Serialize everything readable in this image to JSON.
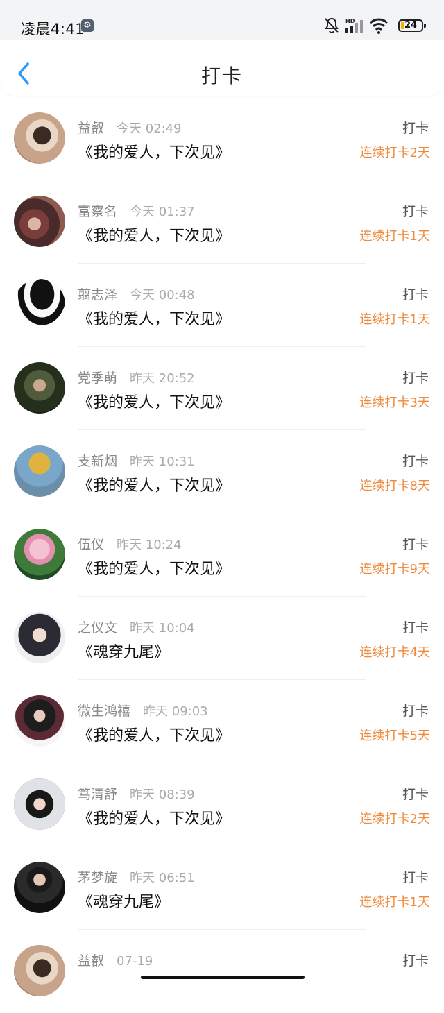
{
  "status_bar": {
    "time": "凌晨4:41",
    "battery": "24",
    "icons": [
      "gear-icon",
      "bell-off-icon",
      "signal-icon",
      "wifi-icon",
      "battery-icon"
    ]
  },
  "header": {
    "title": "打卡",
    "back_icon": "chevron-left-icon"
  },
  "colors": {
    "accent_blue": "#2e9bff",
    "streak_orange": "#ee8a3c",
    "background": "#ffffff",
    "status_bg": "#f3f4f6"
  },
  "entries": [
    {
      "name": "益叡",
      "time": "今天 02:49",
      "book": "《我的爱人，下次见》",
      "action": "打卡",
      "streak": "连续打卡2天"
    },
    {
      "name": "富察名",
      "time": "今天 01:37",
      "book": "《我的爱人，下次见》",
      "action": "打卡",
      "streak": "连续打卡1天"
    },
    {
      "name": "翦志泽",
      "time": "今天 00:48",
      "book": "《我的爱人，下次见》",
      "action": "打卡",
      "streak": "连续打卡1天"
    },
    {
      "name": "党季萌",
      "time": "昨天 20:52",
      "book": "《我的爱人，下次见》",
      "action": "打卡",
      "streak": "连续打卡3天"
    },
    {
      "name": "支新烟",
      "time": "昨天 10:31",
      "book": "《我的爱人，下次见》",
      "action": "打卡",
      "streak": "连续打卡8天"
    },
    {
      "name": "伍仪",
      "time": "昨天 10:24",
      "book": "《我的爱人，下次见》",
      "action": "打卡",
      "streak": "连续打卡9天"
    },
    {
      "name": "之仪文",
      "time": "昨天 10:04",
      "book": "《魂穿九尾》",
      "action": "打卡",
      "streak": "连续打卡4天"
    },
    {
      "name": "微生鸿禧",
      "time": "昨天 09:03",
      "book": "《我的爱人，下次见》",
      "action": "打卡",
      "streak": "连续打卡5天"
    },
    {
      "name": "笃清舒",
      "time": "昨天 08:39",
      "book": "《我的爱人，下次见》",
      "action": "打卡",
      "streak": "连续打卡2天"
    },
    {
      "name": "茅梦旋",
      "time": "昨天 06:51",
      "book": "《魂穿九尾》",
      "action": "打卡",
      "streak": "连续打卡1天"
    },
    {
      "name": "益叡",
      "time": "07-19",
      "book": "",
      "action": "打卡",
      "streak": ""
    }
  ]
}
